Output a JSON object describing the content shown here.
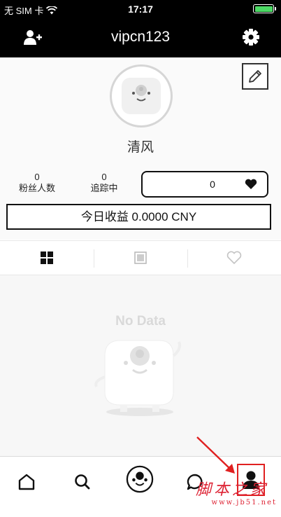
{
  "status_bar": {
    "carrier": "无 SIM 卡",
    "time": "17:17",
    "wifi_icon": "wifi-icon",
    "battery_icon": "battery-icon",
    "battery_level": 1.0
  },
  "nav": {
    "title": "vipcn123",
    "left_icon": "add-user-icon",
    "right_icon": "gear-icon"
  },
  "profile": {
    "nickname": "清风",
    "edit_icon": "pencil-icon",
    "stats": {
      "followers_count": "0",
      "followers_label": "粉丝人数",
      "following_count": "0",
      "following_label": "追踪中"
    },
    "likes": "0",
    "earnings": "今日收益 0.0000 CNY"
  },
  "tabs": [
    {
      "icon": "grid-icon",
      "active": true
    },
    {
      "icon": "square-icon",
      "active": false
    },
    {
      "icon": "heart-outline-icon",
      "active": false
    }
  ],
  "content": {
    "empty_text": "No Data"
  },
  "tabbar": {
    "items": [
      "home-icon",
      "search-icon",
      "camera-icon",
      "chat-icon",
      "profile-icon"
    ],
    "selected": "profile-icon"
  },
  "watermark": {
    "text": "脚本之家",
    "url": "www.jb51.net"
  },
  "colors": {
    "header_bg": "#000000",
    "accent_highlight": "#e02020",
    "battery_fill": "#4cd964"
  }
}
